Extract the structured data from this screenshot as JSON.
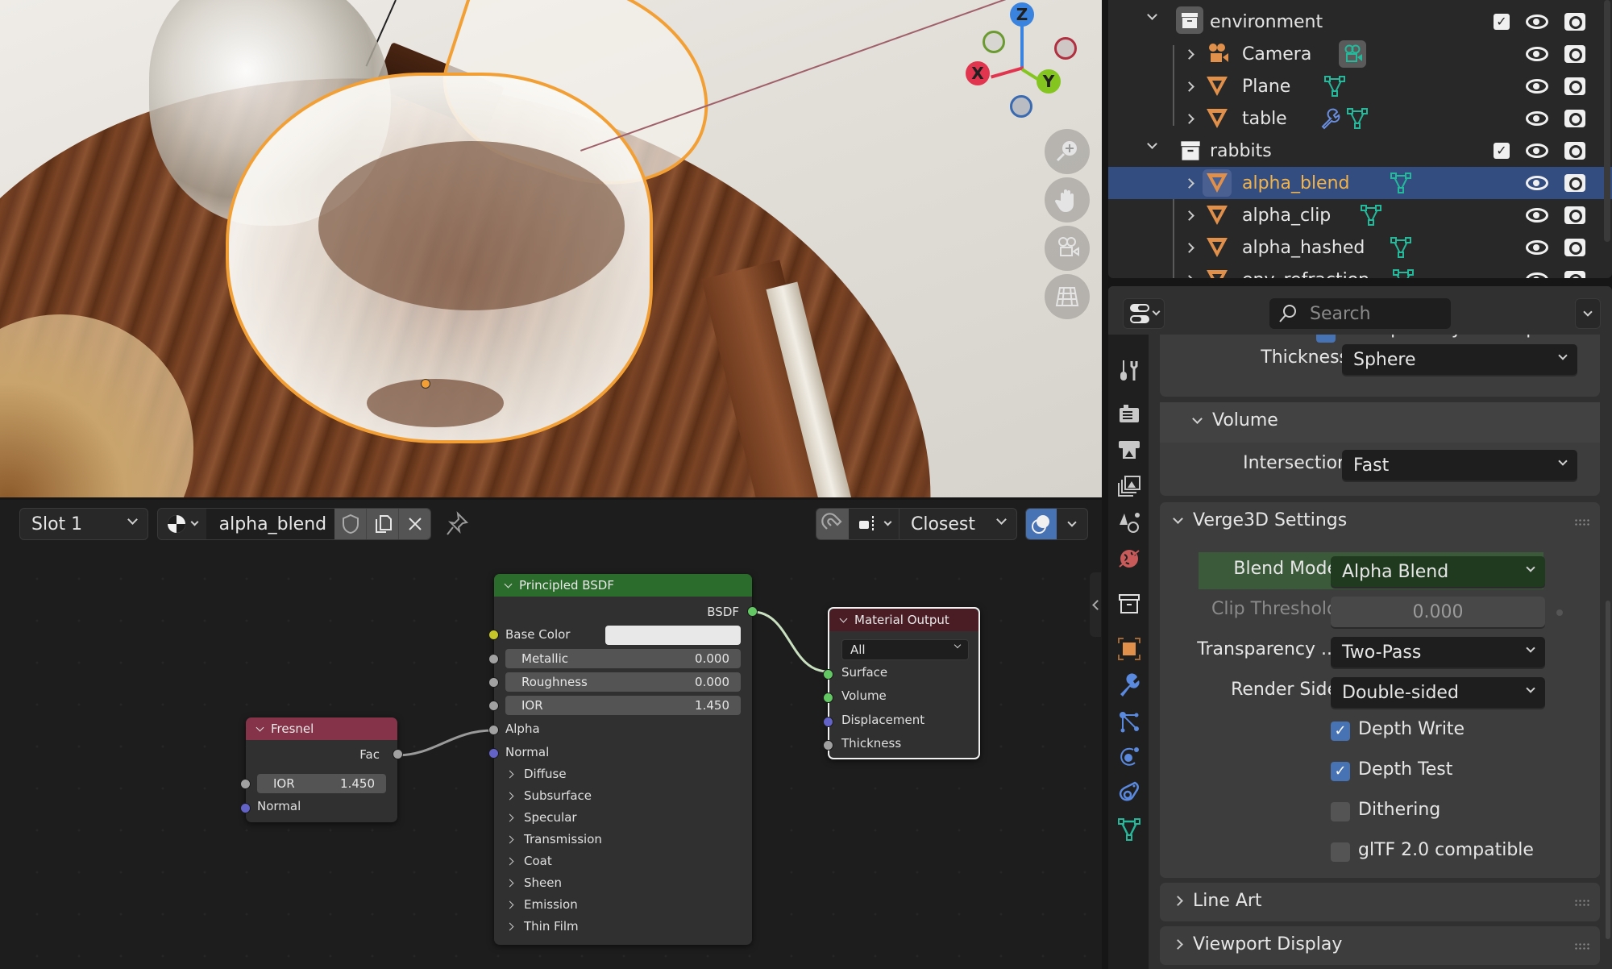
{
  "viewport": {
    "gizmo": {
      "x_label": "X",
      "y_label": "Y",
      "z_label": "Z"
    },
    "nav_buttons": [
      {
        "name": "zoom-icon"
      },
      {
        "name": "hand-pan-icon"
      },
      {
        "name": "camera-view-icon"
      },
      {
        "name": "grid-ortho-icon"
      }
    ],
    "colors": {
      "selection_outline": "#f2a035",
      "x_axis": "#e0344f",
      "y_axis": "#84c520",
      "z_axis": "#3a84e0"
    }
  },
  "node_editor": {
    "header": {
      "slot_label": "Slot 1",
      "material_name": "alpha_blend",
      "snap_mode": "Closest"
    },
    "nodes": {
      "fresnel": {
        "title": "Fresnel",
        "output": "Fac",
        "ior_label": "IOR",
        "ior_value": "1.450",
        "normal_label": "Normal",
        "header_color": "#853349"
      },
      "principled": {
        "title": "Principled BSDF",
        "output": "BSDF",
        "base_color_label": "Base Color",
        "base_color_value": "#e8e8e8",
        "fields": [
          {
            "label": "Metallic",
            "value": "0.000"
          },
          {
            "label": "Roughness",
            "value": "0.000"
          },
          {
            "label": "IOR",
            "value": "1.450"
          }
        ],
        "alpha_label": "Alpha",
        "normal_label": "Normal",
        "subpanels": [
          "Diffuse",
          "Subsurface",
          "Specular",
          "Transmission",
          "Coat",
          "Sheen",
          "Emission",
          "Thin Film"
        ],
        "header_color": "#2b6b2b"
      },
      "material_output": {
        "title": "Material Output",
        "target": "All",
        "inputs": [
          "Surface",
          "Volume",
          "Displacement",
          "Thickness"
        ],
        "header_color": "#4a1d25"
      }
    }
  },
  "outliner": {
    "rows": [
      {
        "label": "environment",
        "type": "collection",
        "expanded": true,
        "checked": true
      },
      {
        "label": "Camera",
        "type": "camera"
      },
      {
        "label": "Plane",
        "type": "mesh"
      },
      {
        "label": "table",
        "type": "mesh",
        "has_modifier": true
      },
      {
        "label": "rabbits",
        "type": "collection",
        "expanded": true,
        "checked": true
      },
      {
        "label": "alpha_blend",
        "type": "mesh",
        "selected": true
      },
      {
        "label": "alpha_clip",
        "type": "mesh"
      },
      {
        "label": "alpha_hashed",
        "type": "mesh"
      },
      {
        "label": "env_refraction",
        "type": "mesh"
      }
    ]
  },
  "properties": {
    "search_placeholder": "Search",
    "cut_off_label": "Transparency Overlap",
    "thickness": {
      "label": "Thickness",
      "value": "Sphere"
    },
    "volume_panel": {
      "title": "Volume",
      "intersection_label": "Intersection",
      "intersection_value": "Fast"
    },
    "verge3d_panel": {
      "title": "Verge3D Settings",
      "blend_mode_label": "Blend Mode",
      "blend_mode_value": "Alpha Blend",
      "clip_threshold_label": "Clip Threshold",
      "clip_threshold_value": "0.000",
      "transparency_label": "Transparency ...",
      "transparency_value": "Two-Pass",
      "render_side_label": "Render Side",
      "render_side_value": "Double-sided",
      "checkboxes": [
        {
          "label": "Depth Write",
          "checked": true
        },
        {
          "label": "Depth Test",
          "checked": true
        },
        {
          "label": "Dithering",
          "checked": false
        },
        {
          "label": "glTF 2.0 compatible",
          "checked": false
        }
      ]
    },
    "collapsed_panels": [
      "Line Art",
      "Viewport Display"
    ],
    "tabs": [
      "tool",
      "render",
      "output",
      "view-layer",
      "scene",
      "world",
      "collection",
      "object",
      "modifiers",
      "particles",
      "physics",
      "constraints",
      "data"
    ]
  }
}
